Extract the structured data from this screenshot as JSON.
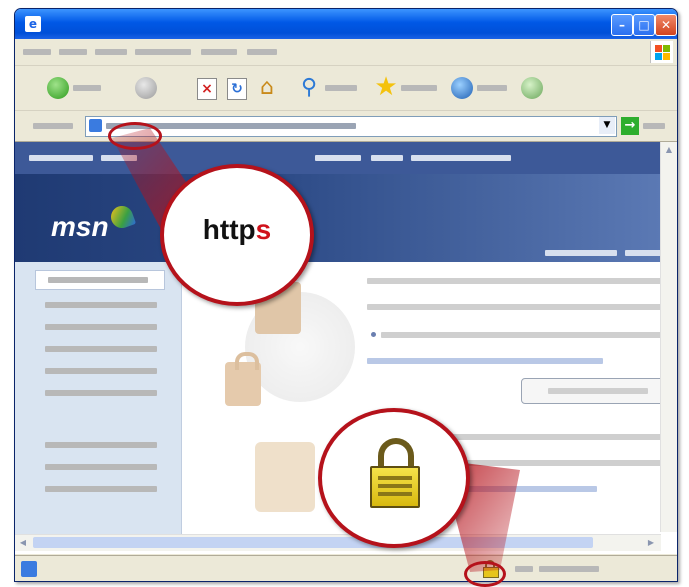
{
  "callout_https": {
    "prefix": "http",
    "suffix": "s"
  },
  "msn_logo": "msn",
  "colors": {
    "accent_red": "#b5121b",
    "xp_blue": "#0058e6",
    "msn_header": "#2c4a86"
  },
  "icons": [
    "back-icon",
    "forward-icon",
    "stop-icon",
    "refresh-icon",
    "home-icon",
    "search-icon",
    "favorites-icon",
    "media-icon",
    "history-icon",
    "padlock-icon",
    "go-icon"
  ]
}
